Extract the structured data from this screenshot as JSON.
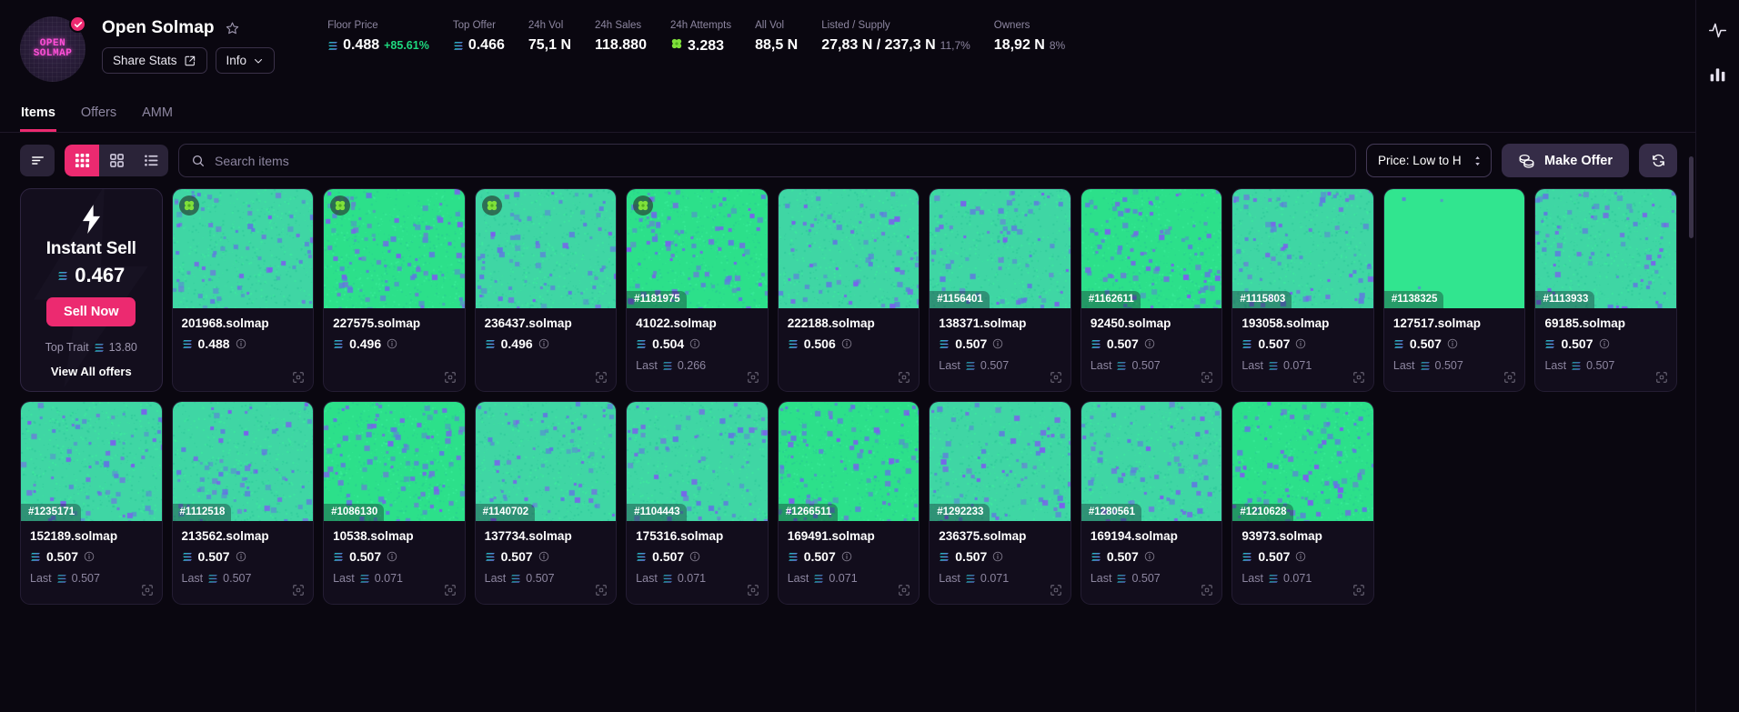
{
  "header": {
    "avatar_text": "OPEN\nSOLMAP",
    "verified_icon": "verified-check-icon",
    "collection_title": "Open Solmap",
    "star_icon": "star-outline-icon",
    "share_stats_label": "Share Stats",
    "share_icon": "share-icon",
    "info_label": "Info",
    "chevron_icon": "chevron-down-icon"
  },
  "stats": [
    {
      "label": "Floor Price",
      "sol": true,
      "value": "0.488",
      "change": "+85.61%",
      "change_dir": "up"
    },
    {
      "label": "Top Offer",
      "sol": true,
      "value": "0.466"
    },
    {
      "label": "24h Vol",
      "value": "75,1 N"
    },
    {
      "label": "24h Sales",
      "value": "118.880"
    },
    {
      "label": "24h Attempts",
      "leaf": true,
      "value": "3.283"
    },
    {
      "label": "All Vol",
      "value": "88,5 N"
    },
    {
      "label": "Listed / Supply",
      "value": "27,83 N / 237,3 N",
      "sub": "11,7%"
    },
    {
      "label": "Owners",
      "value": "18,92 N",
      "sub": "8%"
    }
  ],
  "tabs": [
    {
      "label": "Items",
      "active": true
    },
    {
      "label": "Offers",
      "active": false
    },
    {
      "label": "AMM",
      "active": false
    }
  ],
  "toolbar": {
    "filter_icon": "filter-icon",
    "views": [
      {
        "icon": "grid-small-icon",
        "active": true
      },
      {
        "icon": "grid-large-icon",
        "active": false
      },
      {
        "icon": "list-view-icon",
        "active": false
      }
    ],
    "search_placeholder": "Search items",
    "search_value": "",
    "search_icon": "search-icon",
    "sort_value": "Price: Low to High",
    "sort_icon": "chevron-updown-icon",
    "make_offer_label": "Make Offer",
    "coins_icon": "coins-icon",
    "refresh_icon": "refresh-icon"
  },
  "promo": {
    "bolt_icon": "lightning-bolt-icon",
    "title": "Instant Sell",
    "price": "0.467",
    "sell_label": "Sell Now",
    "top_trait_label": "Top Trait",
    "top_trait_value": "13.80",
    "view_offers_label": "View All offers"
  },
  "colors": {
    "accent_pink": "#ec2a70",
    "green_up": "#1ed97f",
    "art_green": "#3ddc9a",
    "art_purple": "#7b5cf0",
    "bg": "#0a0710"
  },
  "cards": [
    {
      "name": "201968.solmap",
      "price": "0.488",
      "leaf": true,
      "id": "",
      "last": "",
      "seed": 11,
      "hue": "teal"
    },
    {
      "name": "227575.solmap",
      "price": "0.496",
      "leaf": true,
      "id": "",
      "last": "",
      "seed": 22,
      "hue": "green"
    },
    {
      "name": "236437.solmap",
      "price": "0.496",
      "leaf": true,
      "id": "",
      "last": "",
      "seed": 33,
      "hue": "teal"
    },
    {
      "name": "41022.solmap",
      "price": "0.504",
      "leaf": true,
      "id": "#1181975",
      "last": "0.266",
      "seed": 44,
      "hue": "green"
    },
    {
      "name": "222188.solmap",
      "price": "0.506",
      "leaf": false,
      "id": "",
      "last": "",
      "seed": 55,
      "hue": "teal"
    },
    {
      "name": "138371.solmap",
      "price": "0.507",
      "leaf": false,
      "id": "#1156401",
      "last": "0.507",
      "seed": 66,
      "hue": "teal"
    },
    {
      "name": "92450.solmap",
      "price": "0.507",
      "leaf": false,
      "id": "#1162611",
      "last": "0.507",
      "seed": 77,
      "hue": "green"
    },
    {
      "name": "193058.solmap",
      "price": "0.507",
      "leaf": false,
      "id": "#1115803",
      "last": "0.071",
      "seed": 88,
      "hue": "teal"
    },
    {
      "name": "127517.solmap",
      "price": "0.507",
      "leaf": false,
      "id": "#1138325",
      "last": "0.507",
      "seed": 99,
      "hue": "solid"
    },
    {
      "name": "69185.solmap",
      "price": "0.507",
      "leaf": false,
      "id": "#1113933",
      "last": "0.507",
      "seed": 12,
      "hue": "teal"
    },
    {
      "name": "152189.solmap",
      "price": "0.507",
      "leaf": false,
      "id": "#1235171",
      "last": "0.507",
      "seed": 23,
      "hue": "teal"
    },
    {
      "name": "213562.solmap",
      "price": "0.507",
      "leaf": false,
      "id": "#1112518",
      "last": "0.507",
      "seed": 34,
      "hue": "teal"
    },
    {
      "name": "10538.solmap",
      "price": "0.507",
      "leaf": false,
      "id": "#1086130",
      "last": "0.071",
      "seed": 45,
      "hue": "green"
    },
    {
      "name": "137734.solmap",
      "price": "0.507",
      "leaf": false,
      "id": "#1140702",
      "last": "0.507",
      "seed": 56,
      "hue": "teal"
    },
    {
      "name": "175316.solmap",
      "price": "0.507",
      "leaf": false,
      "id": "#1104443",
      "last": "0.071",
      "seed": 67,
      "hue": "teal"
    },
    {
      "name": "169491.solmap",
      "price": "0.507",
      "leaf": false,
      "id": "#1266511",
      "last": "0.071",
      "seed": 78,
      "hue": "green"
    },
    {
      "name": "236375.solmap",
      "price": "0.507",
      "leaf": false,
      "id": "#1292233",
      "last": "0.071",
      "seed": 89,
      "hue": "teal"
    },
    {
      "name": "169194.solmap",
      "price": "0.507",
      "leaf": false,
      "id": "#1280561",
      "last": "0.507",
      "seed": 91,
      "hue": "teal"
    },
    {
      "name": "93973.solmap",
      "price": "0.507",
      "leaf": false,
      "id": "#1210628",
      "last": "0.071",
      "seed": 13,
      "hue": "green"
    }
  ],
  "rail": [
    {
      "icon": "activity-pulse-icon"
    },
    {
      "icon": "bar-chart-icon"
    }
  ]
}
